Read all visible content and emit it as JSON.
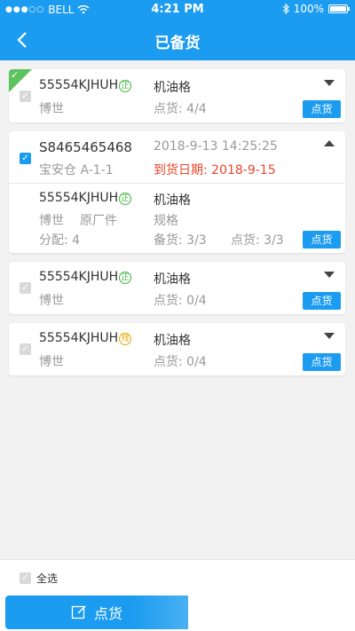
{
  "statusbar": {
    "carrier": "BELL",
    "time": "4:21 PM",
    "battery": "100%",
    "signal_dots": "●●●○○"
  },
  "navbar": {
    "title": "已备货"
  },
  "cards": [
    {
      "code": "55554KJHUH",
      "badge": "正",
      "category": "机油格",
      "brand": "博世",
      "count_label": "点货: 4/4",
      "button": "点货"
    },
    {
      "order": "S8465465468",
      "datetime": "2018-9-13 14:25:25",
      "warehouse": "宝安仓 A-1-1",
      "arrival": "到货日期: 2018-9-15",
      "item": {
        "code": "55554KJHUH",
        "badge": "正",
        "category": "机油格",
        "brand": "博世",
        "type": "原厂件",
        "spec": "规格",
        "alloc": "分配: 4",
        "prepared": "备货: 3/3",
        "counted": "点货: 3/3",
        "button": "点货"
      }
    },
    {
      "code": "55554KJHUH",
      "badge": "正",
      "category": "机油格",
      "brand": "博世",
      "count_label": "点货: 0/4",
      "button": "点货"
    },
    {
      "code": "55554KJHUH",
      "badge": "残",
      "category": "机油格",
      "brand": "博世",
      "count_label": "点货: 0/4",
      "button": "点货"
    }
  ],
  "bottom": {
    "select_all": "全选",
    "action": "点货"
  },
  "colors": {
    "accent": "#1c9cf0",
    "red": "#e8452b",
    "green": "#5ec25e"
  }
}
